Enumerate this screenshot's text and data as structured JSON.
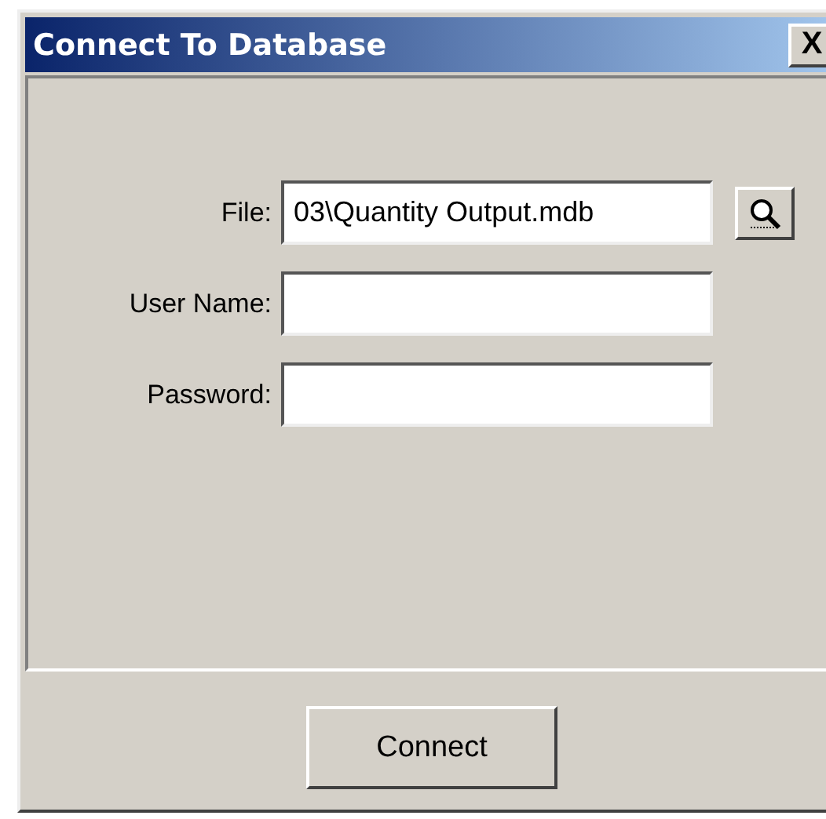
{
  "window": {
    "title": "Connect To Database",
    "close": "X"
  },
  "fields": [
    {
      "label": "File:",
      "value": "03\\Quantity Output.mdb",
      "browse": true
    },
    {
      "label": "User Name:",
      "browse": false
    },
    {
      "label": "Password:",
      "browse": false
    }
  ],
  "buttons": [
    "Connect"
  ]
}
